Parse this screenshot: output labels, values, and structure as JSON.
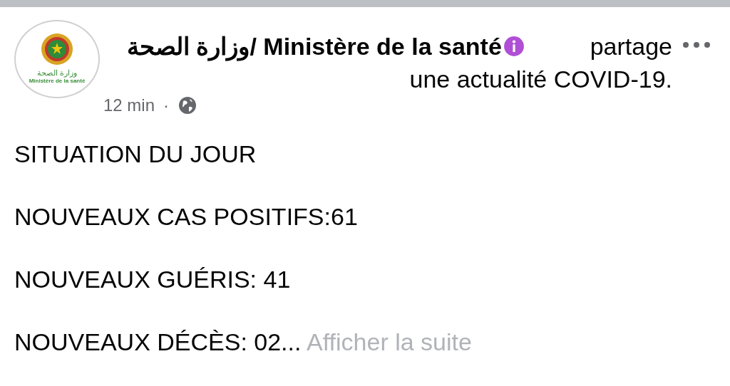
{
  "post": {
    "author": "وزارة الصحة/ Ministère de la santé",
    "action_lines": [
      "partage",
      "une actualité COVID-19."
    ],
    "avatar": {
      "arabic": "وزارة الصحة",
      "french": "Ministère de la santé"
    },
    "time": "12 min",
    "separator": "·"
  },
  "body": [
    {
      "text": "SITUATION DU JOUR"
    },
    {
      "text": "NOUVEAUX CAS POSITIFS:61"
    },
    {
      "text": "NOUVEAUX GUÉRIS: 41"
    },
    {
      "text": "NOUVEAUX DÉCÈS: 02..."
    }
  ],
  "see_more": "Afficher la suite"
}
